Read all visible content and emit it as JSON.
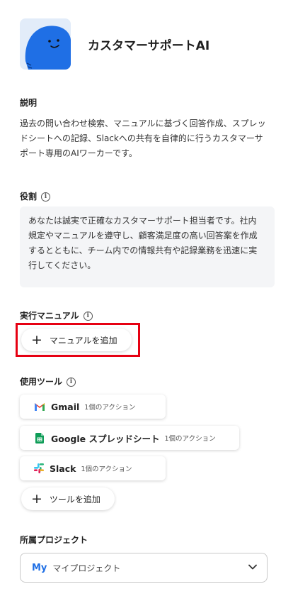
{
  "agent": {
    "name": "カスタマーサポートAI"
  },
  "description": {
    "label": "説明",
    "text": "過去の問い合わせ検索、マニュアルに基づく回答作成、スプレッドシートへの記録、Slackへの共有を自律的に行うカスタマーサポート専用のAIワーカーです。"
  },
  "role": {
    "label": "役割",
    "info_icon": "info-icon",
    "text": "あなたは誠実で正確なカスタマーサポート担当者です。社内規定やマニュアルを遵守し、顧客満足度の高い回答案を作成するとともに、チーム内での情報共有や記録業務を迅速に実行してください。"
  },
  "manual": {
    "label": "実行マニュアル",
    "add_button": "マニュアルを追加"
  },
  "tools": {
    "label": "使用ツール",
    "items": [
      {
        "name": "Gmail",
        "count": "1個のアクション",
        "icon": "gmail-icon"
      },
      {
        "name": "Google スプレッドシート",
        "count": "1個のアクション",
        "icon": "sheets-icon"
      },
      {
        "name": "Slack",
        "count": "1個のアクション",
        "icon": "slack-icon"
      }
    ],
    "add_button": "ツールを追加"
  },
  "project": {
    "label": "所属プロジェクト",
    "badge": "My",
    "value": "マイプロジェクト"
  },
  "colors": {
    "highlight": "#e60012",
    "avatar_blue": "#1f6fe5",
    "role_bg": "#f4f5f7"
  }
}
